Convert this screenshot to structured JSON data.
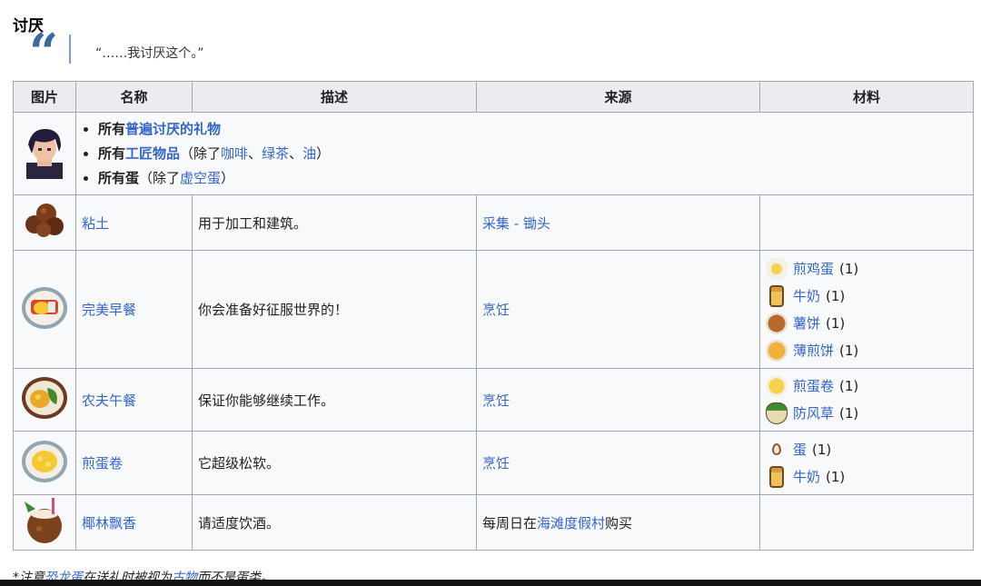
{
  "section": {
    "heading": "讨厌",
    "quote": "“……我讨厌这个。”"
  },
  "table": {
    "headers": [
      "图片",
      "名称",
      "描述",
      "来源",
      "材料"
    ],
    "summary": {
      "line1_prefix": "所有",
      "line1_link": "普遍讨厌的礼物",
      "line2_prefix": "所有",
      "line2_link": "工匠物品",
      "line2_open": "（除了",
      "line2_items": [
        "咖啡",
        "绿茶",
        "油"
      ],
      "line2_sep": "、",
      "line2_close": "）",
      "line3_prefix": "所有蛋",
      "line3_open": "（除了",
      "line3_link": "虚空蛋",
      "line3_close": "）"
    },
    "rows": [
      {
        "name": "粘土",
        "desc": "用于加工和建筑。",
        "source": "采集 - 锄头",
        "materials": []
      },
      {
        "name": "完美早餐",
        "desc": "你会准备好征服世界的！",
        "source": "烹饪",
        "materials": [
          {
            "icon": "fried-egg-icon",
            "name": "煎鸡蛋",
            "count": "(1)"
          },
          {
            "icon": "milk-icon",
            "name": "牛奶",
            "count": "(1)"
          },
          {
            "icon": "hashbrowns-icon",
            "name": "薯饼",
            "count": "(1)"
          },
          {
            "icon": "pancakes-icon",
            "name": "薄煎饼",
            "count": "(1)"
          }
        ]
      },
      {
        "name": "农夫午餐",
        "desc": "保证你能够继续工作。",
        "source": "烹饪",
        "materials": [
          {
            "icon": "omelet-icon",
            "name": "煎蛋卷",
            "count": "(1)"
          },
          {
            "icon": "parsnip-icon",
            "name": "防风草",
            "count": "(1)"
          }
        ]
      },
      {
        "name": "煎蛋卷",
        "desc": "它超级松软。",
        "source": "烹饪",
        "materials": [
          {
            "icon": "egg-icon",
            "name": "蛋",
            "count": "(1)"
          },
          {
            "icon": "milk-icon",
            "name": "牛奶",
            "count": "(1)"
          }
        ]
      },
      {
        "name": "椰林飘香",
        "desc": "请适度饮酒。",
        "source_prefix": "每周日在",
        "source_link": "海滩度假村",
        "source_suffix": "购买",
        "materials": []
      }
    ]
  },
  "note": {
    "prefix": "*注意",
    "link1": "恐龙蛋",
    "mid": "在送礼时被视为",
    "link2": "古物",
    "suffix": "而不是蛋类。"
  },
  "colors": {
    "link": "#3366cc",
    "header_bg": "#eaecf0",
    "border": "#a2a9b1",
    "quote": "#3d6a9e"
  }
}
